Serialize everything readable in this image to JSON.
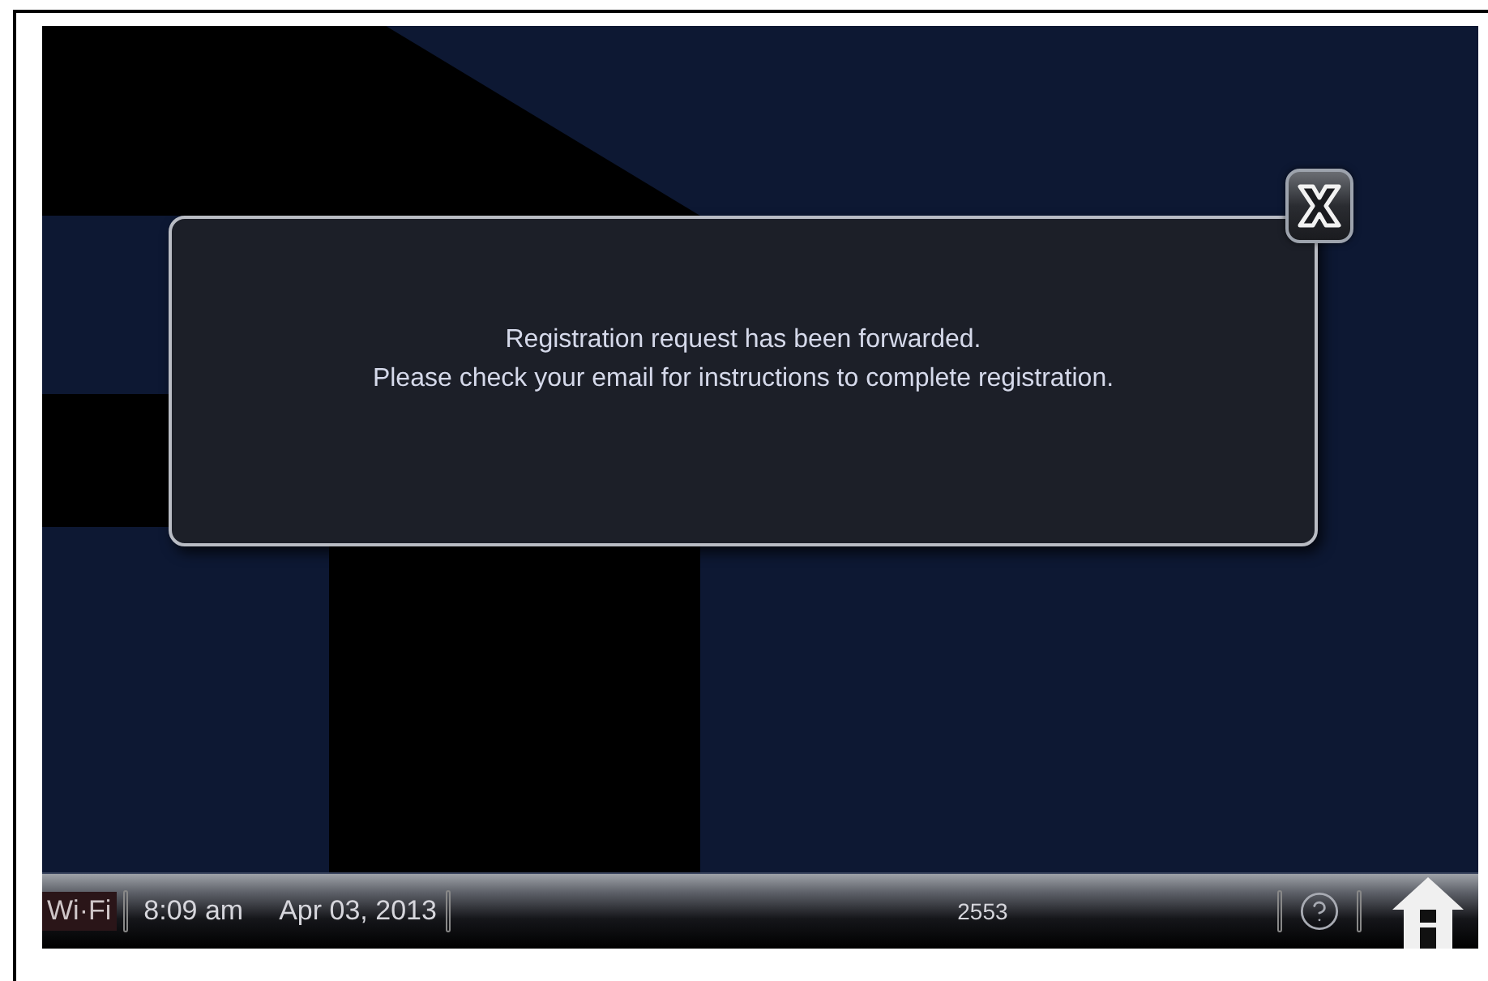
{
  "dialog": {
    "lines": [
      "Registration request has been forwarded.",
      "Please check your email for instructions to complete registration."
    ]
  },
  "status_bar": {
    "wifi": "Wi·Fi",
    "time": "8:09 am",
    "date": "Apr 03, 2013",
    "code": "2553"
  }
}
